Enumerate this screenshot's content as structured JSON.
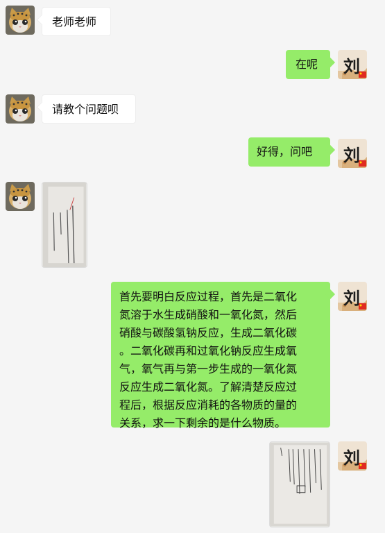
{
  "conversation": {
    "messages": [
      {
        "side": "left",
        "type": "text",
        "text": "老师老师"
      },
      {
        "side": "right",
        "type": "text",
        "text": "在呢"
      },
      {
        "side": "left",
        "type": "text",
        "text": "请教个问题呗"
      },
      {
        "side": "right",
        "type": "text",
        "text": "好得，问吧"
      },
      {
        "side": "left",
        "type": "image",
        "image": "homework-photo"
      },
      {
        "side": "right",
        "type": "text",
        "lines": [
          "首先要明白反应过程，首先是二氧化",
          "氮溶于水生成硝酸和一氧化氮，然后",
          "硝酸与碳酸氢钠反应，生成二氧化碳",
          "。二氧化碳再和过氧化钠反应生成氧",
          "气，氧气再与第一步生成的一氧化氮",
          "反应生成二氧化氮。了解清楚反应过",
          "程后，根据反应消耗的各物质的量的",
          "关系，求一下剩余的是什么物质。"
        ]
      },
      {
        "side": "right",
        "type": "image",
        "image": "handwritten-solution-photo"
      }
    ]
  },
  "avatars": {
    "student": "cat-avatar",
    "teacher": "liu-avatar",
    "teacher_avatar_char": "刘"
  },
  "colors": {
    "background": "#f5f5f5",
    "bubble_sent": "#95ec69",
    "bubble_received": "#ffffff"
  }
}
